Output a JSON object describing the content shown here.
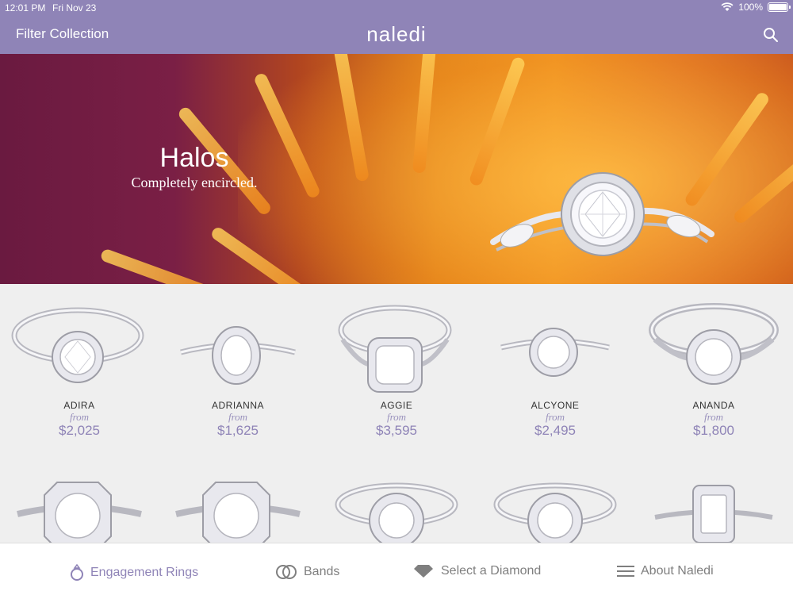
{
  "status": {
    "time": "12:01 PM",
    "date": "Fri Nov 23",
    "battery": "100%"
  },
  "nav": {
    "filter_label": "Filter Collection",
    "logo": "naledi",
    "search_icon": "search-icon"
  },
  "hero": {
    "title": "Halos",
    "subtitle": "Completely encircled."
  },
  "products": [
    {
      "name": "ADIRA",
      "from": "from",
      "price": "$2,025"
    },
    {
      "name": "ADRIANNA",
      "from": "from",
      "price": "$1,625"
    },
    {
      "name": "AGGIE",
      "from": "from",
      "price": "$3,595"
    },
    {
      "name": "ALCYONE",
      "from": "from",
      "price": "$2,495"
    },
    {
      "name": "ANANDA",
      "from": "from",
      "price": "$1,800"
    }
  ],
  "tabs": [
    {
      "label": "Engagement Rings",
      "icon": "ring-icon",
      "active": true
    },
    {
      "label": "Bands",
      "icon": "bands-icon",
      "active": false
    },
    {
      "label": "Select a Diamond",
      "icon": "diamond-icon",
      "active": false
    },
    {
      "label": "About Naledi",
      "icon": "menu-icon",
      "active": false
    }
  ],
  "colors": {
    "brand": "#8f84b7",
    "tab_inactive": "#7f7f7f"
  }
}
